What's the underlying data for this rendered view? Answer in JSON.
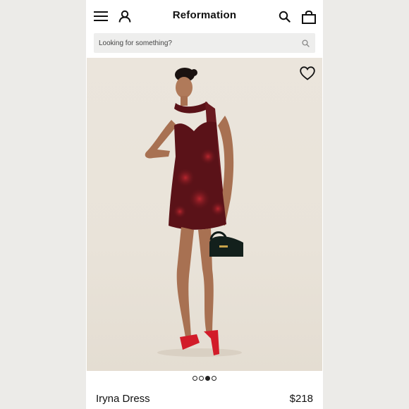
{
  "header": {
    "brand": "Reformation",
    "menu_icon": "hamburger-menu-icon",
    "account_icon": "user-icon",
    "search_icon": "search-icon",
    "bag_icon": "shopping-bag-icon"
  },
  "search": {
    "placeholder": "Looking for something?"
  },
  "gallery": {
    "favorite_icon": "heart-icon",
    "image_count": 4,
    "active_index": 2
  },
  "product": {
    "name": "Iryna Dress",
    "price": "$218"
  },
  "colors": {
    "background": "#ecebe8",
    "photo_backdrop": "#e9e3d9",
    "dress": "#5a1218",
    "sandals": "#d21c2a",
    "text": "#111111"
  }
}
